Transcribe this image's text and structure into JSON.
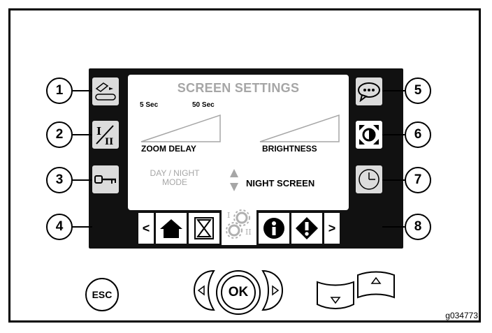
{
  "screen": {
    "title": "SCREEN SETTINGS",
    "zoom_delay": {
      "label": "ZOOM DELAY",
      "min_label": "5 Sec",
      "max_label": "50 Sec"
    },
    "brightness": {
      "label": "BRIGHTNESS"
    },
    "day_night": {
      "label_line1": "DAY / NIGHT",
      "label_line2": "MODE",
      "value": "NIGHT SCREEN"
    }
  },
  "left_buttons": [
    {
      "callout": "1",
      "icon": "calibrate-icon"
    },
    {
      "callout": "2",
      "icon": "switch-i-ii-icon"
    },
    {
      "callout": "3",
      "icon": "key-icon"
    },
    {
      "callout": "4",
      "icon": "blank"
    }
  ],
  "right_buttons": [
    {
      "callout": "5",
      "icon": "speech-bubble-icon"
    },
    {
      "callout": "6",
      "icon": "screen-contrast-icon"
    },
    {
      "callout": "7",
      "icon": "clock-icon"
    },
    {
      "callout": "8",
      "icon": "blank"
    }
  ],
  "tabs": {
    "prev_label": "<",
    "next_label": ">",
    "icons": [
      "home-icon",
      "hourglass-icon",
      "settings-gears-icon",
      "info-icon",
      "warning-icon"
    ]
  },
  "hardware": {
    "esc_label": "ESC",
    "ok_label": "OK"
  },
  "figure_id": "g034773",
  "colors": {
    "display_text_inactive": "#a6a6a6",
    "bezel": "#111111",
    "button_face": "#dcdcdc"
  }
}
